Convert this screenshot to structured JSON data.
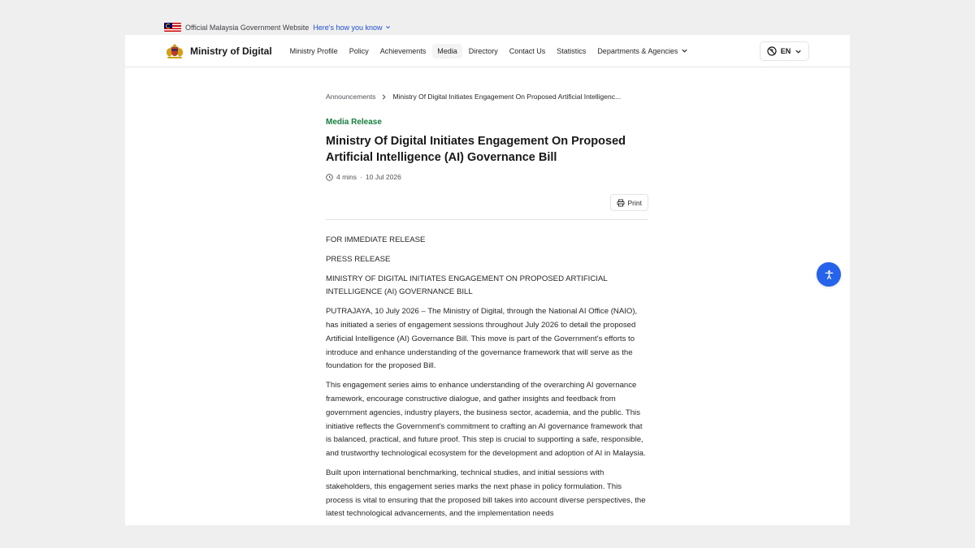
{
  "gov_banner": {
    "official_text": "Official Malaysia Government Website",
    "how_link": "Here's how you know"
  },
  "header": {
    "site_name": "Ministry of Digital",
    "nav": [
      {
        "label": "Ministry Profile"
      },
      {
        "label": "Policy"
      },
      {
        "label": "Achievements"
      },
      {
        "label": "Media",
        "active": true
      },
      {
        "label": "Directory"
      },
      {
        "label": "Contact Us"
      },
      {
        "label": "Statistics"
      },
      {
        "label": "Departments & Agencies"
      }
    ],
    "language": "EN"
  },
  "breadcrumb": {
    "parent": "Announcements",
    "current": "Ministry Of Digital Initiates Engagement On Proposed Artificial Intelligenc..."
  },
  "article": {
    "category": "Media Release",
    "title": "Ministry Of Digital Initiates Engagement On Proposed Artificial Intelligence (AI) Governance Bill",
    "read_time": "4 mins",
    "separator": "·",
    "date": "10 Jul 2026",
    "print_label": "Print",
    "paragraphs": [
      "FOR IMMEDIATE RELEASE",
      "PRESS RELEASE",
      "MINISTRY OF DIGITAL INITIATES ENGAGEMENT ON PROPOSED ARTIFICIAL INTELLIGENCE (AI) GOVERNANCE BILL",
      "PUTRAJAYA, 10 July 2026 – The Ministry of Digital, through the National AI Office (NAIO), has initiated a series of engagement sessions throughout July 2026 to detail the proposed Artificial Intelligence (AI) Governance Bill. This move is part of the Government's efforts to introduce and enhance understanding of the governance framework that will serve as the foundation for the proposed Bill.",
      "This engagement series aims to enhance understanding of the overarching AI governance framework, encourage constructive dialogue, and gather insights and feedback from government agencies, industry players, the business sector, academia, and the public. This initiative reflects the Government's commitment to crafting an AI governance framework that is balanced, practical, and future proof. This step is crucial to supporting a safe, responsible, and trustworthy technological ecosystem for the development and adoption of AI in Malaysia.",
      "Built upon international benchmarking, technical studies, and initial sessions with stakeholders, this engagement series marks the next phase in policy formulation. This process is vital to ensuring that the proposed bill takes into account diverse perspectives, the latest technological advancements, and the implementation needs"
    ]
  },
  "icons": {
    "flag": "malaysia-flag-icon",
    "crest": "coat-of-arms-icon",
    "globe": "globe-icon",
    "clock": "clock-icon",
    "print": "printer-icon",
    "accessibility": "accessibility-icon"
  },
  "colors": {
    "accent": "#2563eb",
    "category": "#15803d",
    "link": "#1d4ed8"
  }
}
